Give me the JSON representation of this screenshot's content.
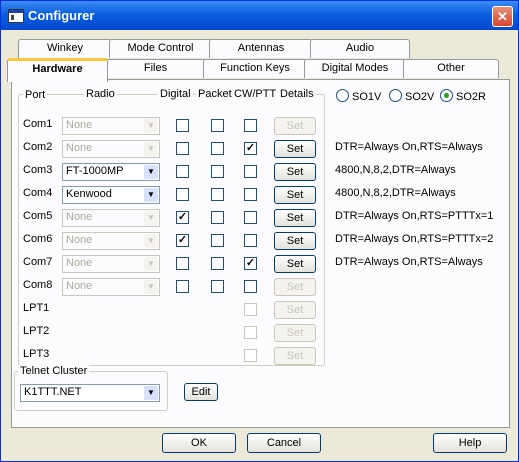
{
  "window": {
    "title": "Configurer",
    "close_glyph": "✕"
  },
  "tabs_row1": [
    "Winkey",
    "Mode Control",
    "Antennas",
    "Audio"
  ],
  "tabs_row2": [
    "Hardware",
    "Files",
    "Function Keys",
    "Digital Modes",
    "Other"
  ],
  "headers": {
    "port": "Port",
    "radio": "Radio",
    "digital": "Digital",
    "packet": "Packet",
    "cwptt": "CW/PTT",
    "details": "Details"
  },
  "so_options": [
    "SO1V",
    "SO2V",
    "SO2R"
  ],
  "so_selected": "SO2R",
  "ports": [
    {
      "port": "Com1",
      "radio": "None",
      "radio_enabled": false,
      "digital": false,
      "packet": false,
      "cwptt": false,
      "set": "Set",
      "set_enabled": false,
      "details": ""
    },
    {
      "port": "Com2",
      "radio": "None",
      "radio_enabled": false,
      "digital": false,
      "packet": false,
      "cwptt": true,
      "set": "Set",
      "set_enabled": true,
      "details": "DTR=Always On,RTS=Always"
    },
    {
      "port": "Com3",
      "radio": "FT-1000MP",
      "radio_enabled": true,
      "digital": false,
      "packet": false,
      "cwptt": false,
      "set": "Set",
      "set_enabled": true,
      "details": "4800,N,8,2,DTR=Always"
    },
    {
      "port": "Com4",
      "radio": "Kenwood",
      "radio_enabled": true,
      "digital": false,
      "packet": false,
      "cwptt": false,
      "set": "Set",
      "set_enabled": true,
      "details": "4800,N,8,2,DTR=Always"
    },
    {
      "port": "Com5",
      "radio": "None",
      "radio_enabled": false,
      "digital": true,
      "packet": false,
      "cwptt": false,
      "set": "Set",
      "set_enabled": true,
      "details": "DTR=Always On,RTS=PTTTx=1"
    },
    {
      "port": "Com6",
      "radio": "None",
      "radio_enabled": false,
      "digital": true,
      "packet": false,
      "cwptt": false,
      "set": "Set",
      "set_enabled": true,
      "details": "DTR=Always On,RTS=PTTTx=2"
    },
    {
      "port": "Com7",
      "radio": "None",
      "radio_enabled": false,
      "digital": false,
      "packet": false,
      "cwptt": true,
      "set": "Set",
      "set_enabled": true,
      "details": "DTR=Always On,RTS=Always"
    },
    {
      "port": "Com8",
      "radio": "None",
      "radio_enabled": false,
      "digital": false,
      "packet": false,
      "cwptt": false,
      "set": "Set",
      "set_enabled": false,
      "details": ""
    }
  ],
  "lpts": [
    {
      "port": "LPT1",
      "cwptt": false,
      "set": "Set"
    },
    {
      "port": "LPT2",
      "cwptt": false,
      "set": "Set"
    },
    {
      "port": "LPT3",
      "cwptt": false,
      "set": "Set"
    }
  ],
  "telnet": {
    "legend": "Telnet Cluster",
    "value": "K1TTT.NET",
    "edit": "Edit"
  },
  "buttons": {
    "ok": "OK",
    "cancel": "Cancel",
    "help": "Help"
  },
  "icons": {
    "dropdown": "chevron-down-icon",
    "check": "checkmark-icon"
  },
  "colors": {
    "titlebar": "#0A5FE0",
    "active_tab_accent": "#FFC83C",
    "close_button": "#D8452B"
  }
}
